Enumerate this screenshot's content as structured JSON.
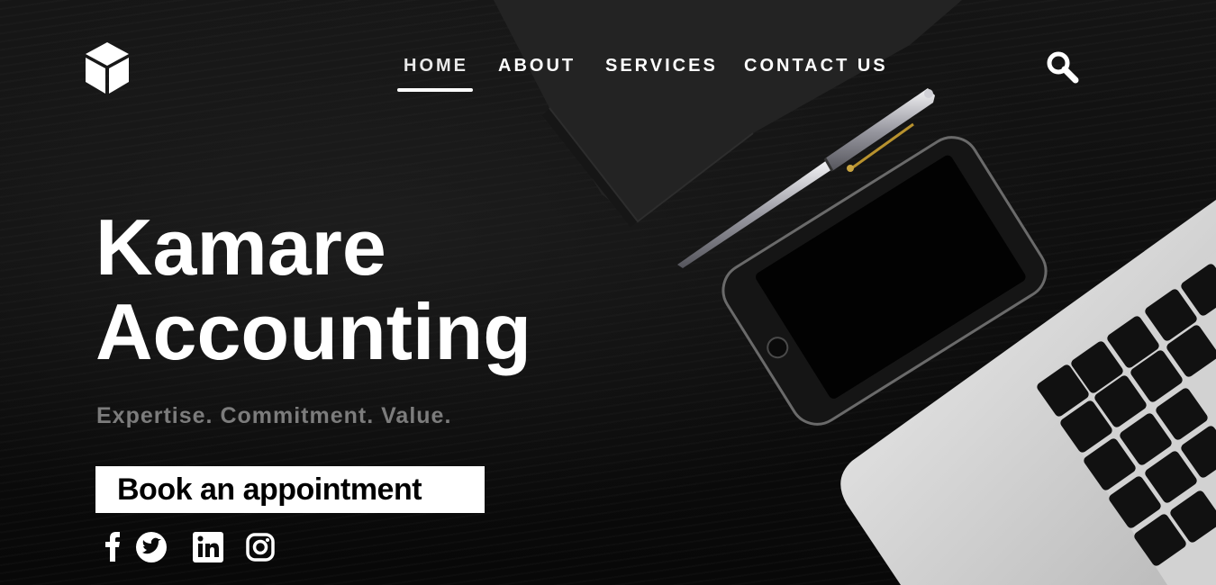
{
  "nav": {
    "items": [
      {
        "label": "HOME",
        "active": true
      },
      {
        "label": "ABOUT",
        "active": false
      },
      {
        "label": "SERVICES",
        "active": false
      },
      {
        "label": "CONTACT US",
        "active": false
      }
    ]
  },
  "header": {
    "logo_icon": "cube-icon",
    "search_icon": "search-icon"
  },
  "hero": {
    "title_line1": "Kamare",
    "title_line2": "Accounting",
    "tagline": "Expertise. Commitment. Value.",
    "cta_label": "Book an appointment"
  },
  "social": [
    "facebook-icon",
    "twitter-icon",
    "linkedin-icon",
    "instagram-icon"
  ],
  "colors": {
    "text": "#ffffff",
    "tagline": "#7c7c7c",
    "background": "#0b0b0b",
    "button": "#ffffff"
  }
}
